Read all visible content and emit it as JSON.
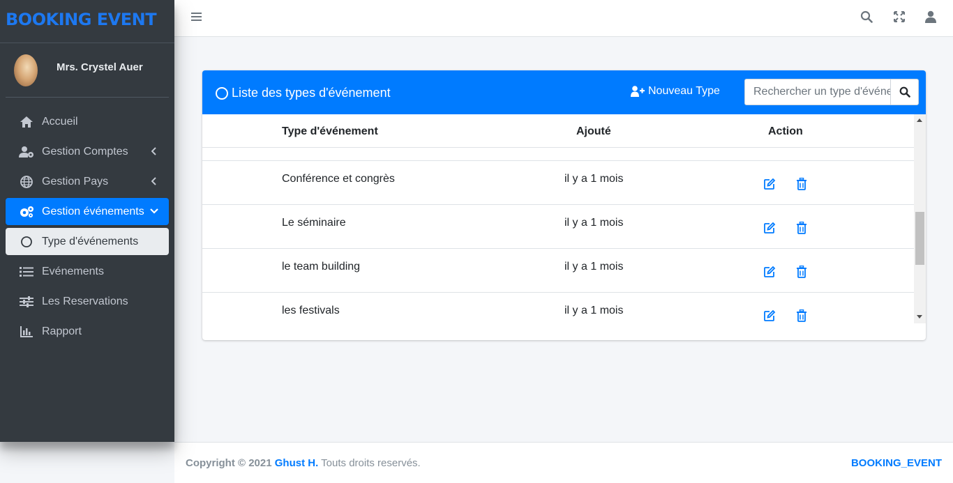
{
  "brand": {
    "title": "BOOKING EVENT"
  },
  "user": {
    "name": "Mrs. Crystel Auer"
  },
  "sidebar": {
    "items": [
      {
        "label": "Accueil",
        "icon": "home-icon"
      },
      {
        "label": "Gestion Comptes",
        "icon": "users-cog-icon"
      },
      {
        "label": "Gestion Pays",
        "icon": "globe-icon"
      },
      {
        "label": "Gestion événements",
        "icon": "cogs-icon"
      },
      {
        "label": "Type d'événements",
        "icon": "circle-icon"
      },
      {
        "label": "Evénements",
        "icon": "list-icon"
      },
      {
        "label": "Les Reservations",
        "icon": "sliders-icon"
      },
      {
        "label": "Rapport",
        "icon": "chart-bar-icon"
      }
    ]
  },
  "card": {
    "title": "Liste des types d'événement",
    "new_button": "Nouveau Type",
    "search_placeholder": "Rechercher un type d'événement"
  },
  "table": {
    "headers": [
      "Type d'événement",
      "Ajouté",
      "Action"
    ],
    "rows": [
      {
        "type": "Conférence et congrès",
        "added": "il y a 1 mois"
      },
      {
        "type": "Le séminaire",
        "added": "il y a 1 mois"
      },
      {
        "type": "le team building",
        "added": "il y a 1 mois"
      },
      {
        "type": "les festivals",
        "added": "il y a 1 mois"
      }
    ]
  },
  "footer": {
    "copyright": "Copyright © 2021",
    "author": "Ghust H.",
    "rights": "Touts droits reservés.",
    "brand": "BOOKING_EVENT"
  },
  "colors": {
    "primary": "#007bff",
    "sidebar": "#343a40"
  }
}
